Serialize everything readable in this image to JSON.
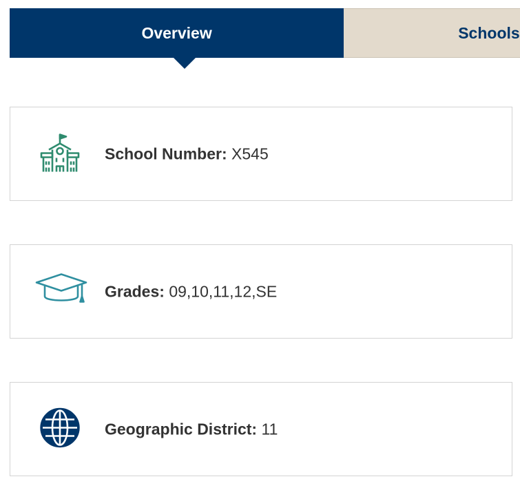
{
  "tabs": {
    "overview": "Overview",
    "schools": "Schools"
  },
  "cards": [
    {
      "icon": "school-building-icon",
      "label": "School Number:",
      "value": "X545"
    },
    {
      "icon": "graduation-cap-icon",
      "label": "Grades:",
      "value": "09,10,11,12,SE"
    },
    {
      "icon": "globe-icon",
      "label": "Geographic District:",
      "value": "11"
    }
  ],
  "colors": {
    "navy": "#00366a",
    "tan": "#e3dacc",
    "green": "#2e8b6e",
    "teal": "#2f8fa0"
  }
}
